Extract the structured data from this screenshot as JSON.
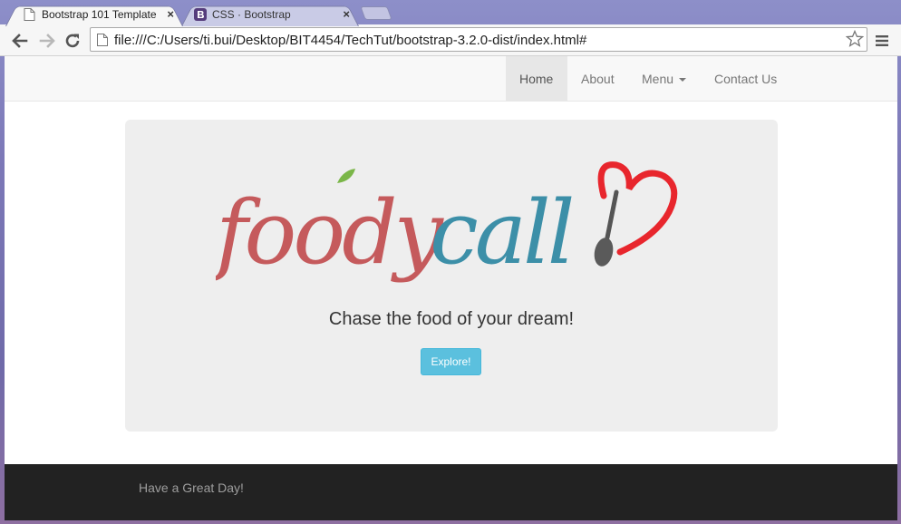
{
  "browser": {
    "tabs": [
      {
        "title": "Bootstrap 101 Template",
        "active": true,
        "close": "×"
      },
      {
        "title": "CSS · Bootstrap",
        "active": false,
        "close": "×"
      }
    ],
    "url": "file:///C:/Users/ti.bui/Desktop/BIT4454/TechTut/bootstrap-3.2.0-dist/index.html#",
    "icons": {
      "back": "back-arrow-icon",
      "forward": "forward-arrow-icon",
      "reload": "reload-icon",
      "bookmark": "star-icon",
      "menu": "hamburger-menu-icon"
    }
  },
  "navbar": {
    "items": [
      {
        "label": "Home",
        "active": true
      },
      {
        "label": "About",
        "active": false
      },
      {
        "label": "Menu",
        "active": false,
        "dropdown": true
      },
      {
        "label": "Contact Us",
        "active": false
      }
    ]
  },
  "hero": {
    "logo": {
      "part1": "foody",
      "part2": "call"
    },
    "tagline": "Chase the food of your dream!",
    "button_label": "Explore!"
  },
  "footer": {
    "text": "Have a Great Day!"
  },
  "colors": {
    "logo_red": "#c55a5c",
    "logo_blue": "#3c8fa8",
    "heart_red": "#e8262d",
    "leaf_green": "#7ab648",
    "button_info": "#5bc0de",
    "footer_bg": "#222222"
  }
}
